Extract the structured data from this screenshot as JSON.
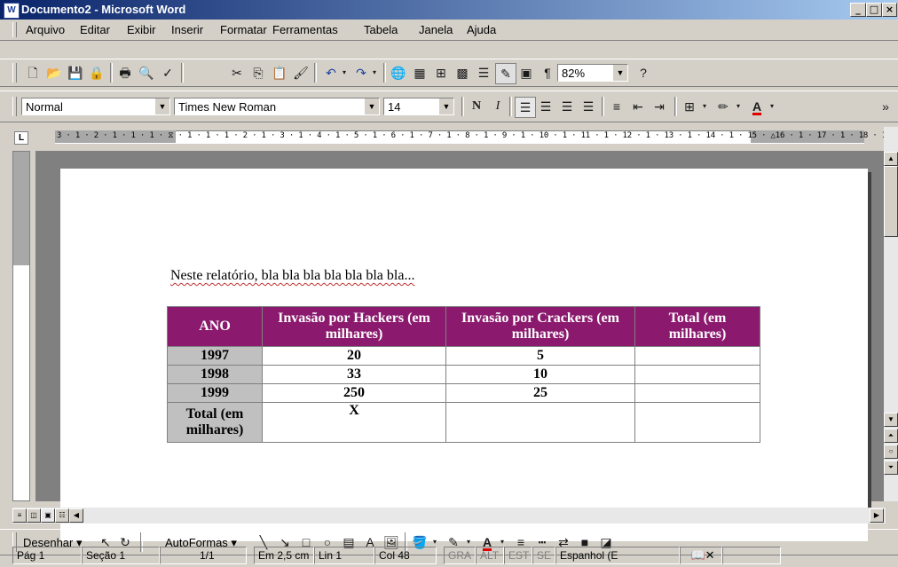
{
  "window": {
    "title": "Documento2 - Microsoft Word",
    "app_icon": "W",
    "min": "_",
    "max": "□",
    "close": "×"
  },
  "menu": [
    "Arquivo",
    "Editar",
    "Exibir",
    "Inserir",
    "Formatar",
    "Ferramentas",
    "Tabela",
    "Janela",
    "Ajuda"
  ],
  "standard_toolbar": {
    "zoom": "82%"
  },
  "formatting_toolbar": {
    "style": "Normal",
    "font": "Times New Roman",
    "size": "14",
    "bold": "N",
    "italic": "I",
    "font_color_letter": "A"
  },
  "ruler": {
    "tab_selector": "L",
    "digits": "3 · 1 · 2 · 1 · 1 · 1 · ⧖ · 1 · 1 · 1 · 2 · 1 · 3 · 1 · 4 · 1 · 5 · 1 · 6 · 1 · 7 · 1 · 8 · 1 · 9 · 1 · 10 · 1 · 11 · 1 · 12 · 1 · 13 · 1 · 14 · 1 · 15 · △16 · 1 · 17 · 1 · 18 · 1"
  },
  "document": {
    "paragraph": "Neste relatório, bla bla bla bla bla bla bla...",
    "table": {
      "headers": [
        "ANO",
        "Invasão por Hackers (em milhares)",
        "Invasão por Crackers (em milhares)",
        "Total (em milhares)"
      ],
      "rows": [
        [
          "1997",
          "20",
          "5",
          ""
        ],
        [
          "1998",
          "33",
          "10",
          ""
        ],
        [
          "1999",
          "250",
          "25",
          ""
        ],
        [
          "Total (em milhares)",
          "X",
          "",
          ""
        ]
      ]
    }
  },
  "drawing_toolbar": {
    "draw_label": "Desenhar",
    "autoshapes_label": "AutoFormas"
  },
  "status": {
    "page": "Pág 1",
    "section": "Seção 1",
    "pages": "1/1",
    "position": "Em 2,5 cm",
    "line": "Lin 1",
    "column": "Col 48",
    "rec": "GRA",
    "trk": "ALT",
    "ext": "EST",
    "ovr": "SE",
    "language": "Espanhol (E"
  },
  "colors": {
    "title_start": "#0a246a",
    "title_end": "#a6caf0",
    "table_header": "#8b1a6e",
    "year_cell": "#c0c0c0"
  }
}
